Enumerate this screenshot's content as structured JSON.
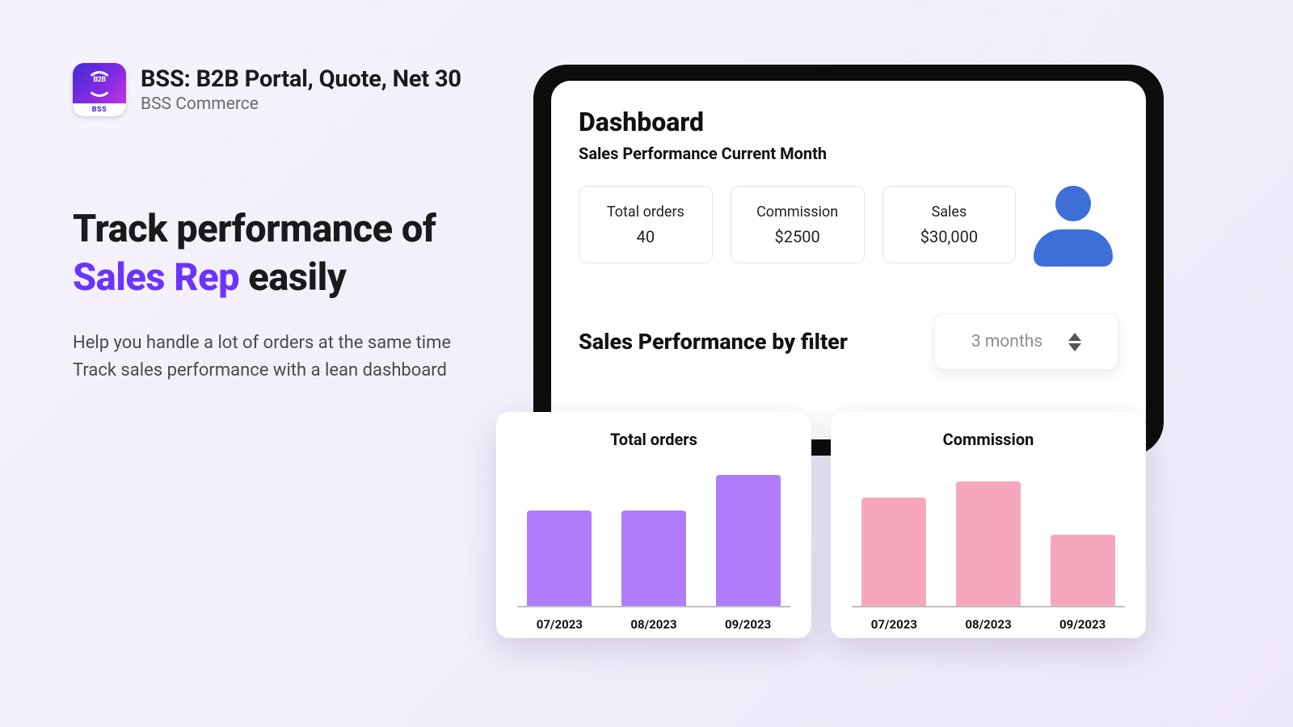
{
  "app": {
    "title": "BSS: B2B Portal, Quote, Net 30",
    "subtitle": "BSS Commerce",
    "icon_b2b": "B2B",
    "icon_label": "BSS"
  },
  "hero": {
    "line1": "Track performance of",
    "accent": "Sales Rep",
    "line2_suffix": " easily",
    "desc_line1": "Help you handle a lot of orders at the same time",
    "desc_line2": "Track sales performance with a lean dashboard"
  },
  "dashboard": {
    "title": "Dashboard",
    "subtitle": "Sales Performance Current Month",
    "cards": {
      "total_orders": {
        "label": "Total orders",
        "value": "40"
      },
      "commission": {
        "label": "Commission",
        "value": "$2500"
      },
      "sales": {
        "label": "Sales",
        "value": "$30,000"
      }
    },
    "filter_title": "Sales Performance by filter",
    "filter_value": "3 months"
  },
  "chart_data": [
    {
      "type": "bar",
      "title": "Total orders",
      "categories": [
        "07/2023",
        "08/2023",
        "09/2023"
      ],
      "values": [
        120,
        120,
        164
      ],
      "color": "#b07cfb",
      "xlabel": "",
      "ylabel": "",
      "ylim": [
        0,
        186
      ]
    },
    {
      "type": "bar",
      "title": "Commission",
      "categories": [
        "07/2023",
        "08/2023",
        "09/2023"
      ],
      "values": [
        136,
        156,
        90
      ],
      "color": "#f7a7bd",
      "xlabel": "",
      "ylabel": "",
      "ylim": [
        0,
        186
      ]
    }
  ]
}
